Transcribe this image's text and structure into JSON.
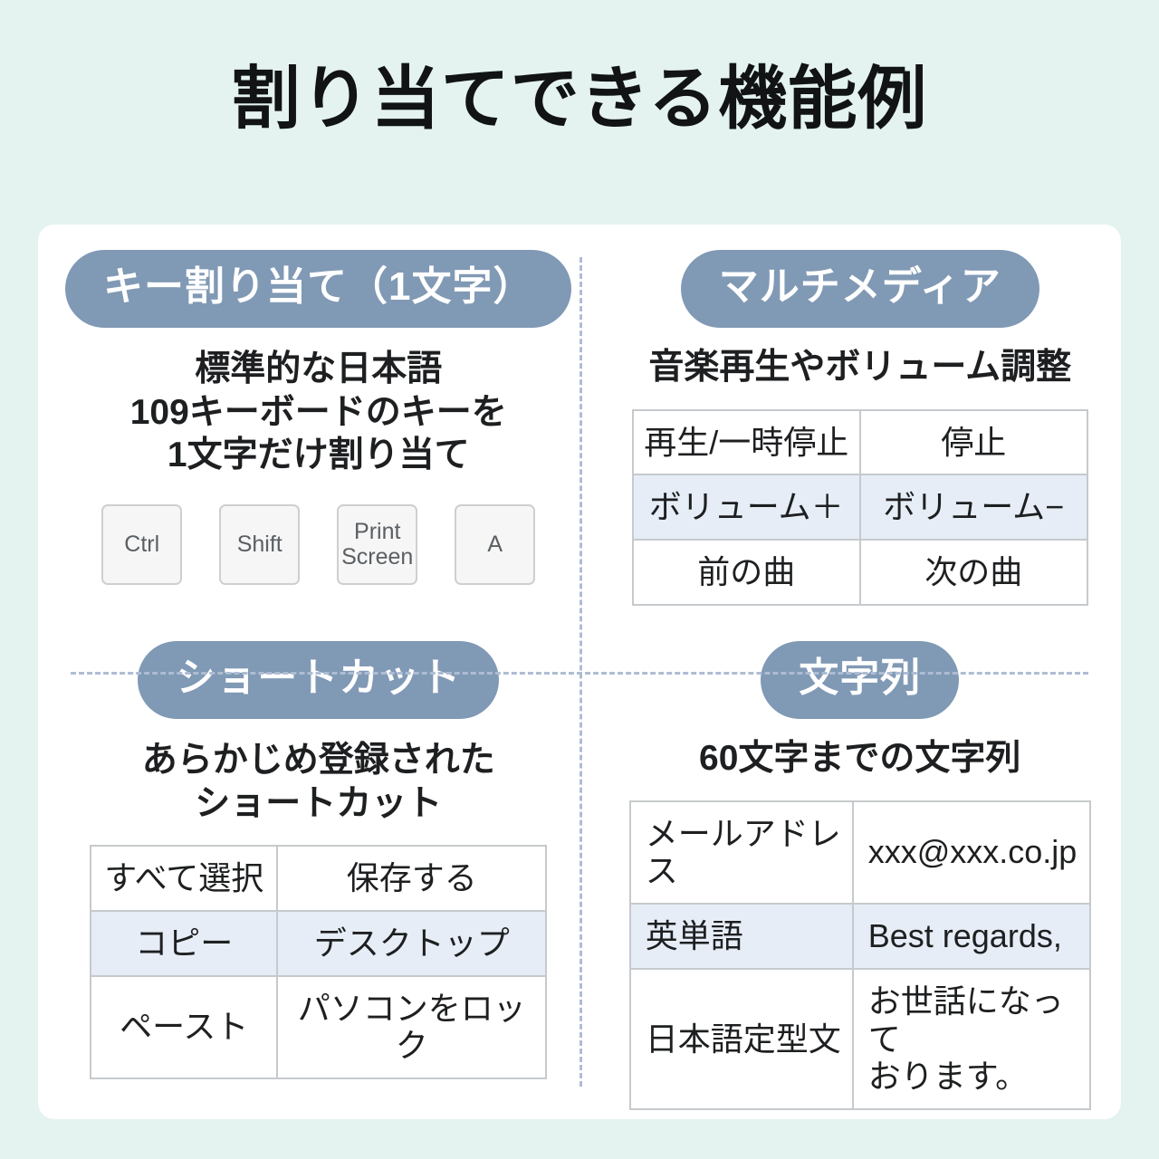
{
  "page": {
    "title": "割り当てできる機能例",
    "background_color": "#e4f2f0",
    "card_color": "#ffffff",
    "accent_color": "#8099b5",
    "divider_color": "#aebdd3",
    "table_border_color": "#c6cacd",
    "table_alt_row_color": "#e7edf6"
  },
  "sections": {
    "key_assign": {
      "heading": "キー割り当て（1文字）",
      "description": "標準的な日本語\n109キーボードのキーを\n1文字だけ割り当て",
      "keys": [
        {
          "label": "Ctrl"
        },
        {
          "label": "Shift"
        },
        {
          "label": "Print\nScreen"
        },
        {
          "label": "A"
        }
      ]
    },
    "multimedia": {
      "heading": "マルチメディア",
      "description": "音楽再生やボリューム調整",
      "table": {
        "rows": [
          {
            "highlight": false,
            "cells": [
              "再生/一時停止",
              "停止"
            ]
          },
          {
            "highlight": true,
            "cells": [
              "ボリューム＋",
              "ボリューム−"
            ]
          },
          {
            "highlight": false,
            "cells": [
              "前の曲",
              "次の曲"
            ]
          }
        ]
      }
    },
    "shortcut": {
      "heading": "ショートカット",
      "description": "あらかじめ登録された\nショートカット",
      "table": {
        "rows": [
          {
            "highlight": false,
            "cells": [
              "すべて選択",
              "保存する"
            ]
          },
          {
            "highlight": true,
            "cells": [
              "コピー",
              "デスクトップ"
            ]
          },
          {
            "highlight": false,
            "cells": [
              "ペースト",
              "パソコンをロック"
            ]
          }
        ]
      }
    },
    "text_string": {
      "heading": "文字列",
      "description": "60文字までの文字列",
      "table": {
        "rows": [
          {
            "highlight": false,
            "cells": [
              "メールアドレス",
              "xxx@xxx.co.jp"
            ]
          },
          {
            "highlight": true,
            "cells": [
              "英単語",
              "Best regards,"
            ]
          },
          {
            "highlight": false,
            "cells": [
              "日本語定型文",
              "お世話になって\nおります。"
            ]
          }
        ]
      }
    }
  }
}
